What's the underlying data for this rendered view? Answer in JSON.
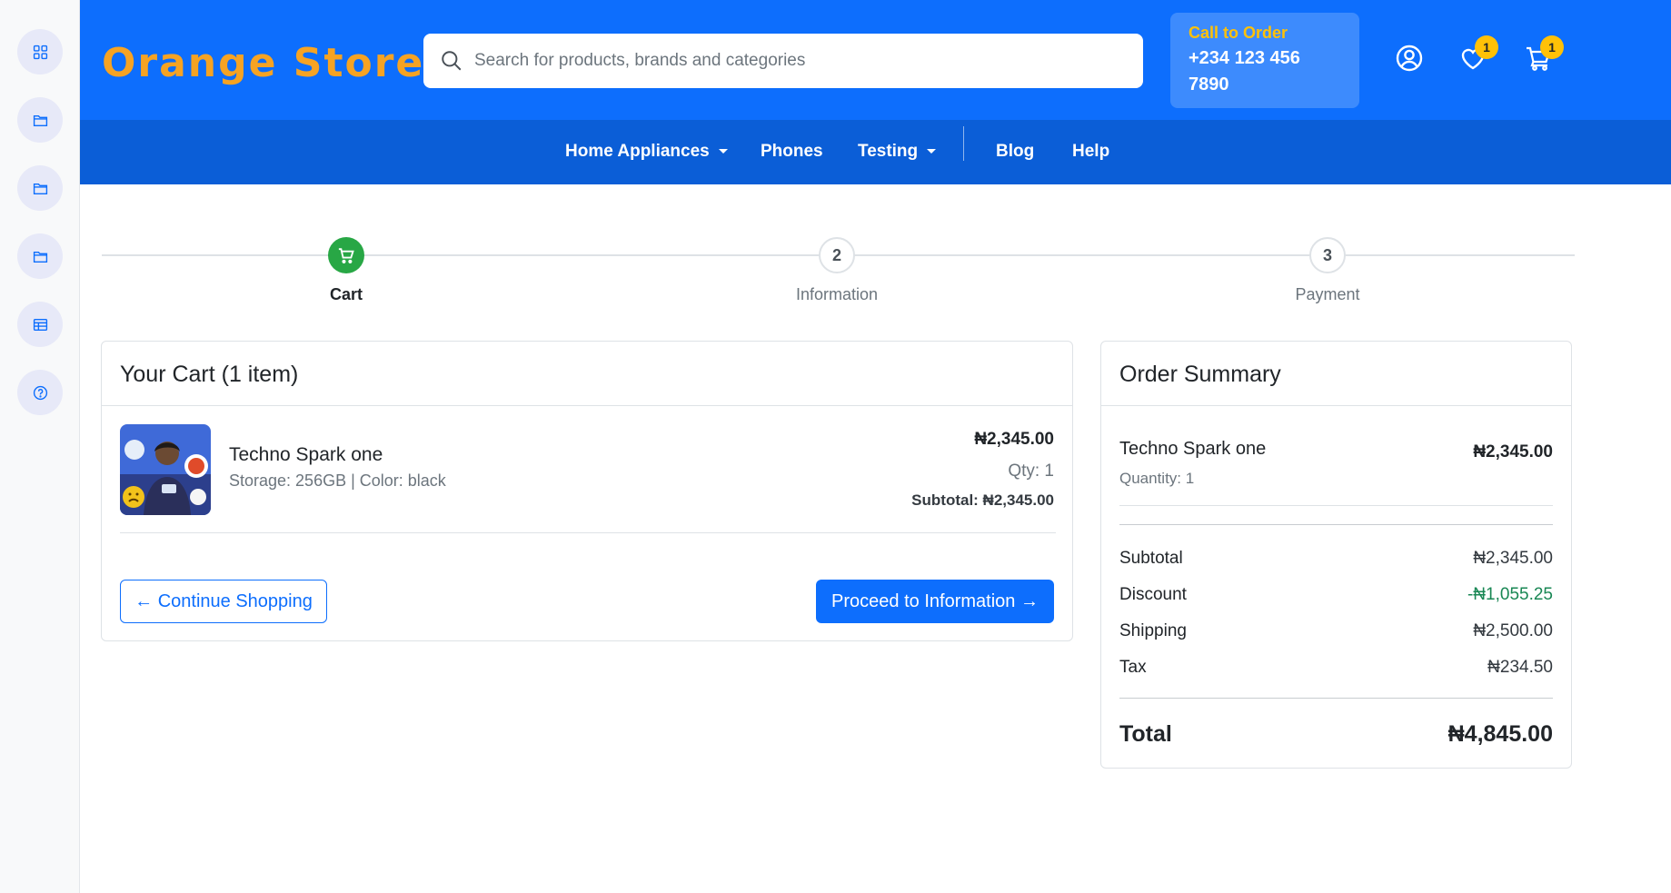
{
  "colors": {
    "primary": "#0d6efd",
    "nav": "#0b5ed7",
    "brand": "#f6a323",
    "badge": "#ffc107",
    "success": "#28a745",
    "discount": "#198754"
  },
  "sidebar": {
    "items": [
      {
        "icon": "grid-icon"
      },
      {
        "icon": "folder-icon"
      },
      {
        "icon": "folder-icon"
      },
      {
        "icon": "folder-icon"
      },
      {
        "icon": "table-icon"
      },
      {
        "icon": "help-circle-icon"
      }
    ]
  },
  "header": {
    "brand": "Orange Stores",
    "search_placeholder": "Search for products, brands and categories",
    "call_label": "Call to Order",
    "call_number_line1": "+234 123 456",
    "call_number_line2": "7890",
    "wishlist_count": "1",
    "cart_count": "1"
  },
  "nav": {
    "items": [
      {
        "label": "Home Appliances",
        "dropdown": true
      },
      {
        "label": "Phones",
        "dropdown": false
      },
      {
        "label": "Testing",
        "dropdown": true
      },
      {
        "label": "Blog",
        "dropdown": false
      },
      {
        "label": "Help",
        "dropdown": false
      }
    ]
  },
  "steps": [
    {
      "label": "Cart",
      "number": "",
      "state": "done"
    },
    {
      "label": "Information",
      "number": "2",
      "state": "todo"
    },
    {
      "label": "Payment",
      "number": "3",
      "state": "todo"
    }
  ],
  "cart": {
    "title": "Your Cart (1 item)",
    "item": {
      "name": "Techno Spark one",
      "meta": "Storage: 256GB | Color: black",
      "price": "₦2,345.00",
      "qty": "Qty: 1",
      "subtotal": "Subtotal: ₦2,345.00"
    },
    "continue_label": "← Continue Shopping",
    "proceed_label": "Proceed to Information →"
  },
  "summary": {
    "title": "Order Summary",
    "item_name": "Techno Spark one",
    "item_qty": "Quantity: 1",
    "item_price": "₦2,345.00",
    "rows": [
      {
        "label": "Subtotal",
        "value": "₦2,345.00"
      },
      {
        "label": "Discount",
        "value": "-₦1,055.25"
      },
      {
        "label": "Shipping",
        "value": "₦2,500.00"
      },
      {
        "label": "Tax",
        "value": "₦234.50"
      }
    ],
    "total_label": "Total",
    "total_value": "₦4,845.00"
  }
}
